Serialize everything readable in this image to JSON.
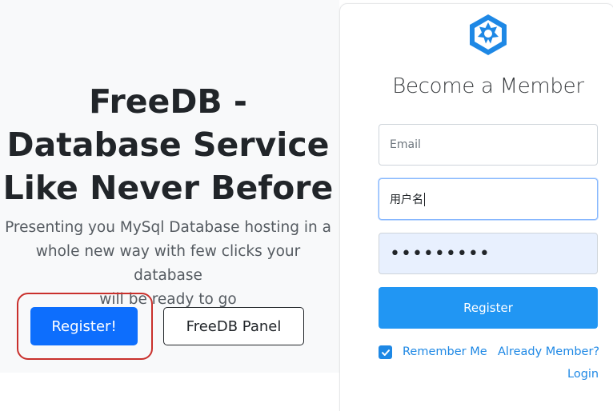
{
  "hero": {
    "title_line1": "FreeDB -",
    "title_line2": "Database Service",
    "title_line3": "Like Never Before",
    "subtitle_line1": "Presenting you MySql Database hosting in a",
    "subtitle_line2": "whole new way with few clicks your database",
    "subtitle_line3": "will be ready to go",
    "register_label": "Register!",
    "panel_label": "FreeDB Panel"
  },
  "form": {
    "title": "Become a Member",
    "email_placeholder": "Email",
    "username_value": "用户名",
    "password_mask": "•••••••••",
    "submit_label": "Register",
    "remember_label": "Remember Me",
    "remember_checked": true,
    "already_label": "Already Member?",
    "login_label": "Login"
  },
  "colors": {
    "primary": "#0d6efd",
    "accent": "#2196f3",
    "link": "#1e88e5",
    "highlight": "#c9302c"
  },
  "icons": {
    "logo": "hexagon-star-logo-icon",
    "checkbox": "check-icon"
  }
}
